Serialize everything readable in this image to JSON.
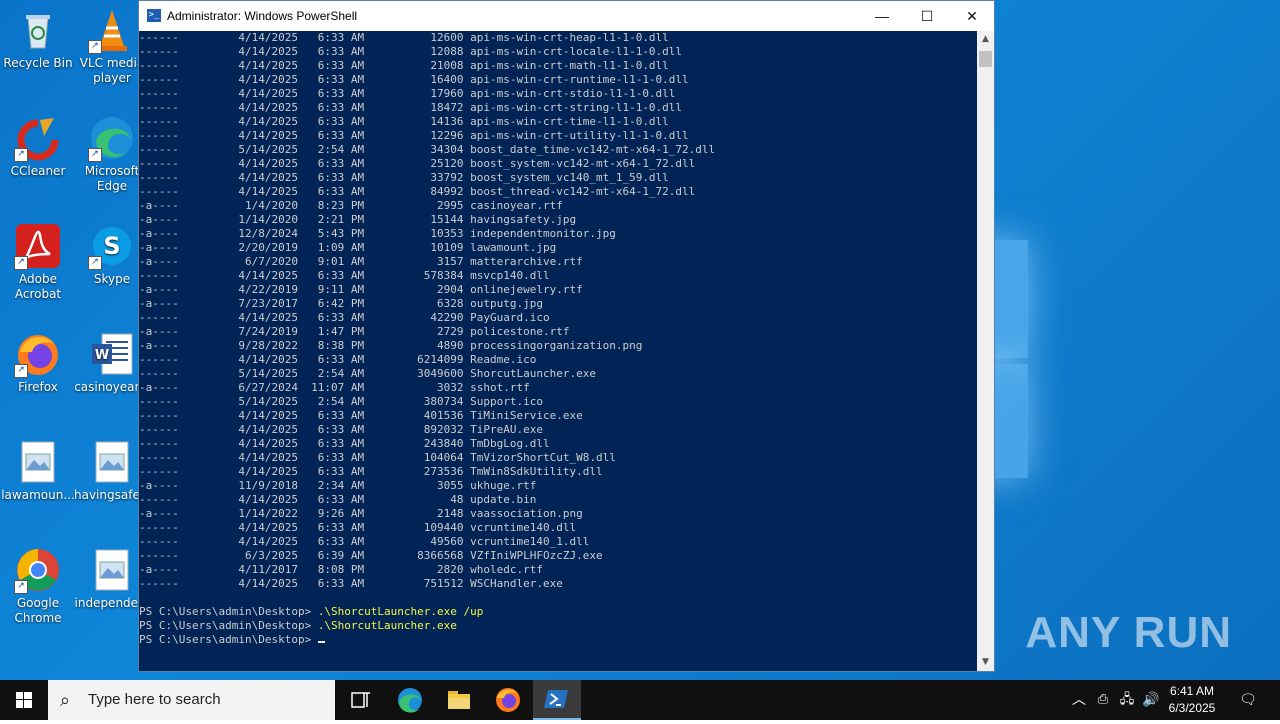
{
  "desktop": {
    "icons": [
      {
        "label": "Recycle Bin"
      },
      {
        "label": "VLC media player"
      },
      {
        "label": "CCleaner"
      },
      {
        "label": "Microsoft Edge"
      },
      {
        "label": "Adobe Acrobat"
      },
      {
        "label": "Skype"
      },
      {
        "label": "Firefox"
      },
      {
        "label": "casinoyear..."
      },
      {
        "label": "lawamoun..."
      },
      {
        "label": "havingsafe..."
      },
      {
        "label": "Google Chrome"
      },
      {
        "label": "independe..."
      }
    ],
    "watermark": "ANY RUN"
  },
  "window": {
    "title": "Administrator: Windows PowerShell",
    "minimize_glyph": "—",
    "maximize_glyph": "☐",
    "close_glyph": "✕"
  },
  "console": {
    "listing": [
      "------         4/14/2025   6:33 AM          12600 api-ms-win-crt-heap-l1-1-0.dll",
      "------         4/14/2025   6:33 AM          12088 api-ms-win-crt-locale-l1-1-0.dll",
      "------         4/14/2025   6:33 AM          21008 api-ms-win-crt-math-l1-1-0.dll",
      "------         4/14/2025   6:33 AM          16400 api-ms-win-crt-runtime-l1-1-0.dll",
      "------         4/14/2025   6:33 AM          17960 api-ms-win-crt-stdio-l1-1-0.dll",
      "------         4/14/2025   6:33 AM          18472 api-ms-win-crt-string-l1-1-0.dll",
      "------         4/14/2025   6:33 AM          14136 api-ms-win-crt-time-l1-1-0.dll",
      "------         4/14/2025   6:33 AM          12296 api-ms-win-crt-utility-l1-1-0.dll",
      "------         5/14/2025   2:54 AM          34304 boost_date_time-vc142-mt-x64-1_72.dll",
      "------         4/14/2025   6:33 AM          25120 boost_system-vc142-mt-x64-1_72.dll",
      "------         4/14/2025   6:33 AM          33792 boost_system_vc140_mt_1_59.dll",
      "------         4/14/2025   6:33 AM          84992 boost_thread-vc142-mt-x64-1_72.dll",
      "-a----          1/4/2020   8:23 PM           2995 casinoyear.rtf",
      "-a----         1/14/2020   2:21 PM          15144 havingsafety.jpg",
      "-a----         12/8/2024   5:43 PM          10353 independentmonitor.jpg",
      "-a----         2/20/2019   1:09 AM          10109 lawamount.jpg",
      "-a----          6/7/2020   9:01 AM           3157 matterarchive.rtf",
      "------         4/14/2025   6:33 AM         578384 msvcp140.dll",
      "-a----         4/22/2019   9:11 AM           2904 onlinejewelry.rtf",
      "-a----         7/23/2017   6:42 PM           6328 outputg.jpg",
      "------         4/14/2025   6:33 AM          42290 PayGuard.ico",
      "-a----         7/24/2019   1:47 PM           2729 policestone.rtf",
      "-a----         9/28/2022   8:38 PM           4890 processingorganization.png",
      "------         4/14/2025   6:33 AM        6214099 Readme.ico",
      "------         5/14/2025   2:54 AM        3049600 ShorcutLauncher.exe",
      "-a----         6/27/2024  11:07 AM           3032 sshot.rtf",
      "------         5/14/2025   2:54 AM         380734 Support.ico",
      "------         4/14/2025   6:33 AM         401536 TiMiniService.exe",
      "------         4/14/2025   6:33 AM         892032 TiPreAU.exe",
      "------         4/14/2025   6:33 AM         243840 TmDbgLog.dll",
      "------         4/14/2025   6:33 AM         104064 TmVizorShortCut_W8.dll",
      "------         4/14/2025   6:33 AM         273536 TmWin8SdkUtility.dll",
      "-a----         11/9/2018   2:34 AM           3055 ukhuge.rtf",
      "------         4/14/2025   6:33 AM             48 update.bin",
      "-a----         1/14/2022   9:26 AM           2148 vaassociation.png",
      "------         4/14/2025   6:33 AM         109440 vcruntime140.dll",
      "------         4/14/2025   6:33 AM          49560 vcruntime140_1.dll",
      "------          6/3/2025   6:39 AM        8366568 VZfIniWPLHFOzcZJ.exe",
      "-a----         4/11/2017   8:08 PM           2820 wholedc.rtf",
      "------         4/14/2025   6:33 AM         751512 WSCHandler.exe"
    ],
    "prompt": "PS C:\\Users\\admin\\Desktop> ",
    "commands": [
      ".\\ShorcutLauncher.exe /up",
      ".\\ShorcutLauncher.exe"
    ]
  },
  "taskbar": {
    "search_placeholder": "Type here to search",
    "time": "6:41 AM",
    "date": "6/3/2025",
    "icons": [
      "windows-start-icon",
      "search-icon",
      "task-view-icon",
      "edge-icon",
      "file-explorer-icon",
      "firefox-icon",
      "powershell-icon",
      "chevron-up-icon",
      "meet-now-icon",
      "network-icon",
      "volume-icon",
      "notification-icon"
    ]
  },
  "colors": {
    "console_bg": "#012456",
    "console_text": "#cccccc",
    "command_text": "#f5f543",
    "taskbar_bg": "#101010"
  }
}
